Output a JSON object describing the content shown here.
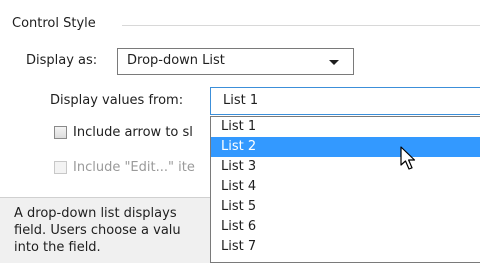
{
  "section": {
    "title": "Control Style"
  },
  "display_as": {
    "label": "Display as:",
    "value": "Drop-down List"
  },
  "display_values": {
    "label": "Display values from:",
    "value": "List 1"
  },
  "checkbox_arrow": {
    "label": "Include arrow to sl",
    "checked": false
  },
  "checkbox_edit": {
    "label": "Include \"Edit...\" ite",
    "checked": false,
    "enabled": false
  },
  "description": {
    "lines": [
      "A drop-down list displays",
      "field. Users choose a valu",
      "into the field."
    ]
  },
  "dropdown": {
    "options": [
      "List 1",
      "List 2",
      "List 3",
      "List 4",
      "List 5",
      "List 6",
      "List 7"
    ],
    "selected_index": 1
  },
  "colors": {
    "selection": "#3399ff",
    "focus_border": "#3c8fd9"
  }
}
